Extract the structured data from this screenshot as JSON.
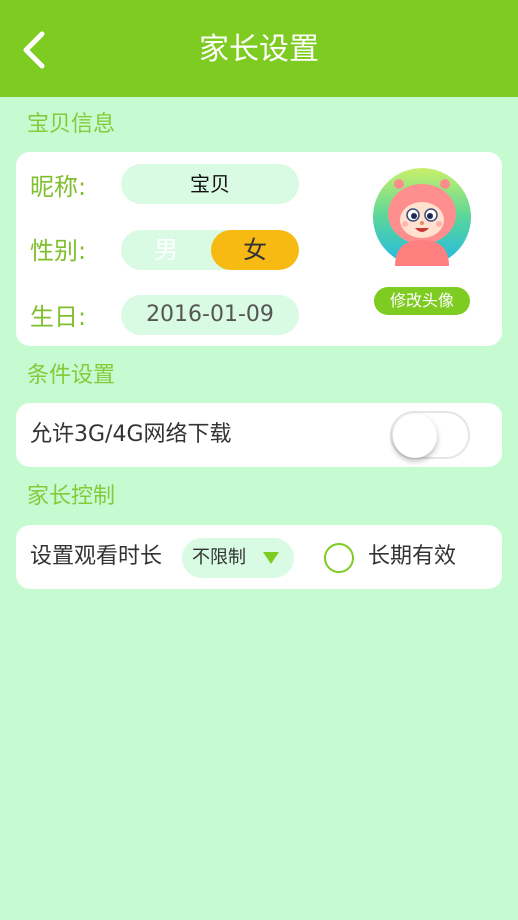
{
  "nav": {
    "title": "家长设置",
    "back_icon": "chevron-left-icon"
  },
  "sections": {
    "baby_info": "宝贝信息",
    "conditions": "条件设置",
    "parental": "家长控制"
  },
  "baby_info": {
    "nickname_label": "昵称:",
    "nickname_value": "宝贝",
    "gender_label": "性别:",
    "gender_male": "男",
    "gender_female": "女",
    "gender_selected": "女",
    "birthday_label": "生日:",
    "birthday_value": "2016-01-09",
    "avatar_edit_label": "修改头像"
  },
  "conditions": {
    "network_label": "允许3G/4G网络下载",
    "network_toggle_on": false
  },
  "parental": {
    "watch_time_label": "设置观看时长",
    "watch_time_value": "不限制",
    "long_term_label": "长期有效",
    "long_term_checked": false
  },
  "colors": {
    "nav_green": "#7ecb22",
    "label_green": "#7fbf2e",
    "page_bg": "#c6fbd2",
    "pill_bg": "#d9fbe3",
    "female_selected": "#f7ba12"
  }
}
